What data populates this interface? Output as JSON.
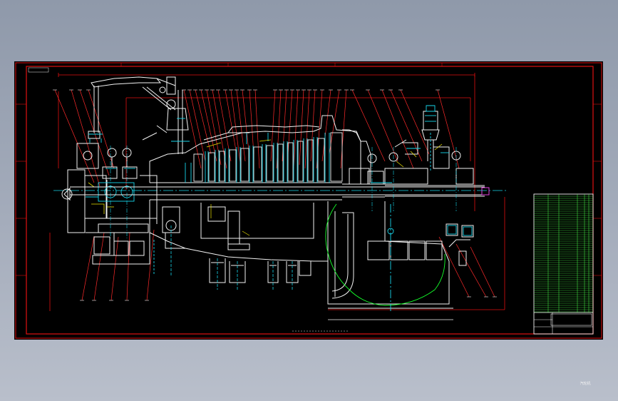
{
  "drawing": {
    "title_block_text": "汽轮机",
    "colors": {
      "background": "#000000",
      "frame": "#e01010",
      "outline": "#f2f2f2",
      "leader": "#ff2a2a",
      "centerline": "#17d6ea",
      "section": "#e8e000",
      "steam_path": "#14ff2a",
      "table_lines": "#4cff4c",
      "shaft_end": "#e040e0"
    }
  }
}
